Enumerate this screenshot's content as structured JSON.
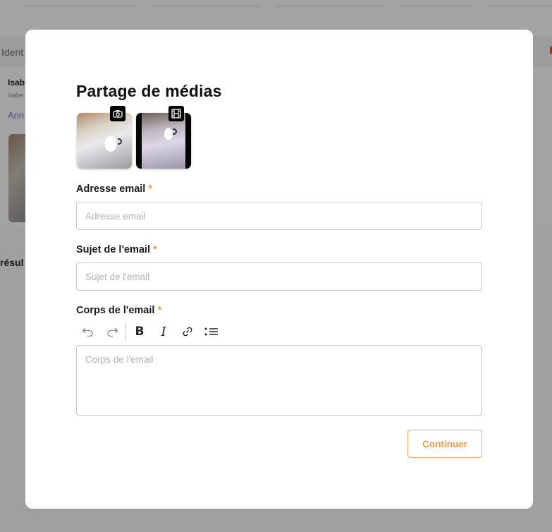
{
  "background": {
    "tab_text": "Ident",
    "name": "Isab",
    "sub": "Isabe",
    "link": "Ann",
    "results": "résul"
  },
  "modal": {
    "title": "Partage de médias",
    "media": [
      {
        "type": "photo",
        "badge_icon": "camera-icon"
      },
      {
        "type": "video",
        "badge_icon": "film-icon"
      }
    ],
    "fields": {
      "email": {
        "label": "Adresse email",
        "required_mark": "*",
        "placeholder": "Adresse email",
        "value": ""
      },
      "subject": {
        "label": "Sujet de l'email",
        "required_mark": "*",
        "placeholder": "Sujet de l'email",
        "value": ""
      },
      "body": {
        "label": "Corps de l'email",
        "required_mark": "*",
        "placeholder": "Corps de l'email"
      }
    },
    "toolbar": {
      "undo_icon": "↶",
      "redo_icon": "↷",
      "bold": "B",
      "italic": "I",
      "link_icon": "link-icon",
      "list_icon": "bullet-list-icon"
    },
    "continue_label": "Continuer"
  },
  "colors": {
    "accent": "#f39a4b",
    "overlay": "rgba(0,0,0,0.36)"
  }
}
